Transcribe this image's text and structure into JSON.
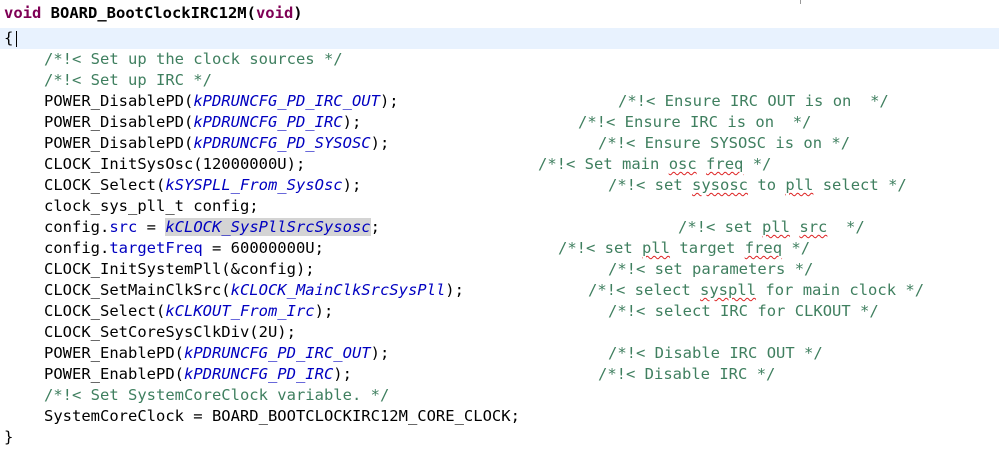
{
  "lines": [
    {
      "segs": [
        {
          "c": "kw",
          "t": "void"
        },
        {
          "c": "fn",
          "t": " BOARD_BootClockIRC12M("
        },
        {
          "c": "kw",
          "t": "void"
        },
        {
          "c": "fn",
          "t": ")"
        }
      ]
    },
    {
      "segs": [
        {
          "c": "plain",
          "t": "{"
        }
      ]
    },
    {
      "segs": [
        {
          "c": "cmt",
          "t": "/*!< Set up the clock sources */"
        }
      ]
    },
    {
      "segs": [
        {
          "c": "cmt",
          "t": "/*!< Set up IRC */"
        }
      ]
    },
    {
      "segs": [
        {
          "c": "plain",
          "t": "POWER_DisablePD("
        },
        {
          "c": "const",
          "t": "kPDRUNCFG_PD_IRC_OUT"
        },
        {
          "c": "plain",
          "t": ");"
        }
      ],
      "comment": "/*!< Ensure IRC OUT is on  */"
    },
    {
      "segs": [
        {
          "c": "plain",
          "t": "POWER_DisablePD("
        },
        {
          "c": "const",
          "t": "kPDRUNCFG_PD_IRC"
        },
        {
          "c": "plain",
          "t": ");"
        }
      ],
      "comment": "/*!< Ensure IRC is on  */"
    },
    {
      "segs": [
        {
          "c": "plain",
          "t": "POWER_DisablePD("
        },
        {
          "c": "const",
          "t": "kPDRUNCFG_PD_SYSOSC"
        },
        {
          "c": "plain",
          "t": ");"
        }
      ],
      "comment": "/*!< Ensure SYSOSC is on */"
    },
    {
      "segs": [
        {
          "c": "plain",
          "t": "CLOCK_InitSysOsc(12000000U);"
        }
      ],
      "comment": "/*!< Set main osc freq */"
    },
    {
      "segs": [
        {
          "c": "plain",
          "t": "CLOCK_Select("
        },
        {
          "c": "const",
          "t": "kSYSPLL_From_SysOsc"
        },
        {
          "c": "plain",
          "t": ");"
        }
      ],
      "comment": "/*!< set sysosc to pll select */"
    },
    {
      "segs": [
        {
          "c": "plain",
          "t": "clock_sys_pll_t config;"
        }
      ]
    },
    {
      "segs": [
        {
          "c": "plain",
          "t": "config."
        },
        {
          "c": "field",
          "t": "src"
        },
        {
          "c": "plain",
          "t": " = "
        },
        {
          "c": "const hl",
          "t": "kCLOCK_SysPllSrcSysosc"
        },
        {
          "c": "plain",
          "t": ";"
        }
      ],
      "comment": "/*!< set pll src  */"
    },
    {
      "segs": [
        {
          "c": "plain",
          "t": "config."
        },
        {
          "c": "field",
          "t": "targetFreq"
        },
        {
          "c": "plain",
          "t": " = 60000000U;"
        }
      ],
      "comment": "/*!< set pll target freq */"
    },
    {
      "segs": [
        {
          "c": "plain",
          "t": "CLOCK_InitSystemPll(&config);"
        }
      ],
      "comment": "/*!< set parameters */"
    },
    {
      "segs": [
        {
          "c": "plain",
          "t": "CLOCK_SetMainClkSrc("
        },
        {
          "c": "const",
          "t": "kCLOCK_MainClkSrcSysPll"
        },
        {
          "c": "plain",
          "t": ");"
        }
      ],
      "comment": "/*!< select syspll for main clock */"
    },
    {
      "segs": [
        {
          "c": "plain",
          "t": "CLOCK_Select("
        },
        {
          "c": "const",
          "t": "kCLKOUT_From_Irc"
        },
        {
          "c": "plain",
          "t": ");"
        }
      ],
      "comment": "/*!< select IRC for CLKOUT */"
    },
    {
      "segs": [
        {
          "c": "plain",
          "t": "CLOCK_SetCoreSysClkDiv(2U);"
        }
      ]
    },
    {
      "segs": [
        {
          "c": "plain",
          "t": "POWER_EnablePD("
        },
        {
          "c": "const",
          "t": "kPDRUNCFG_PD_IRC_OUT"
        },
        {
          "c": "plain",
          "t": ");"
        }
      ],
      "comment": "/*!< Disable IRC OUT */"
    },
    {
      "segs": [
        {
          "c": "plain",
          "t": "POWER_EnablePD("
        },
        {
          "c": "const",
          "t": "kPDRUNCFG_PD_IRC"
        },
        {
          "c": "plain",
          "t": ");"
        }
      ],
      "comment": "/*!< Disable IRC */"
    },
    {
      "segs": [
        {
          "c": "cmt",
          "t": "/*!< Set SystemCoreClock variable. */"
        }
      ]
    },
    {
      "segs": [
        {
          "c": "plain",
          "t": "SystemCoreClock = BOARD_BOOTCLOCKIRC12M_CORE_CLOCK;"
        }
      ]
    },
    {
      "segs": [
        {
          "c": "plain",
          "t": "}"
        }
      ]
    }
  ]
}
